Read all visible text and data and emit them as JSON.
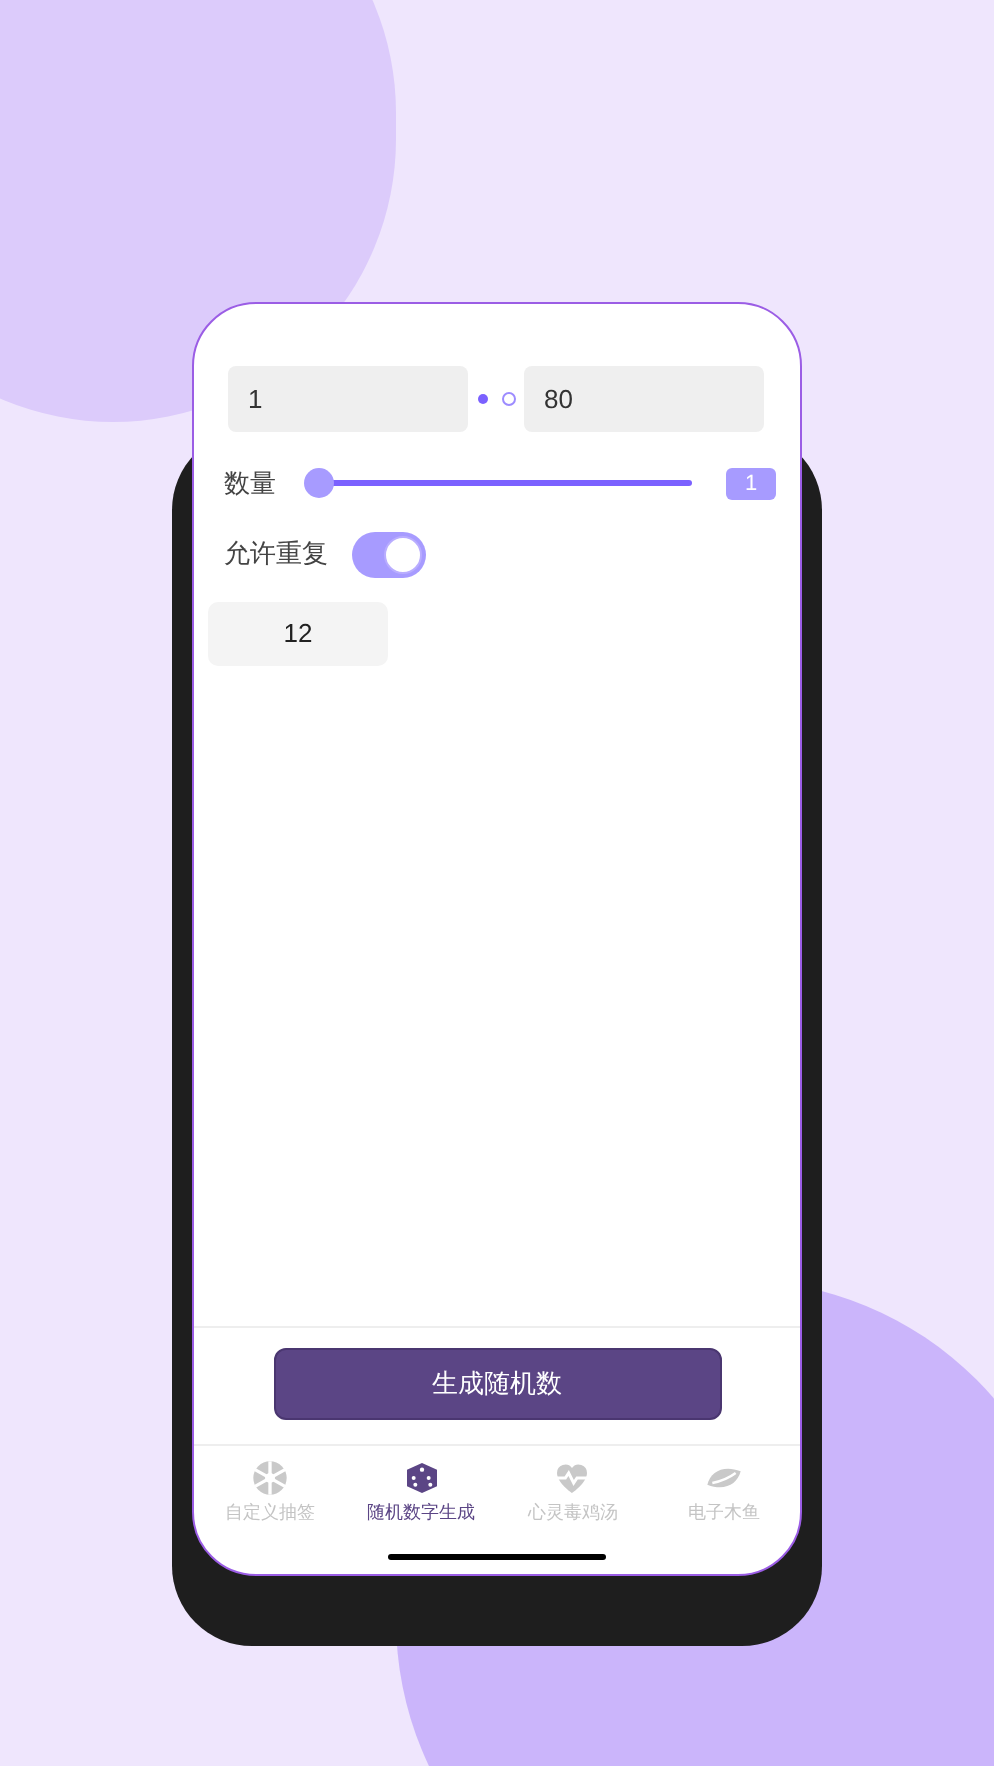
{
  "range": {
    "min_value": "1",
    "max_value": "80",
    "dots": [
      {
        "selected": true
      },
      {
        "selected": false
      }
    ]
  },
  "count": {
    "label": "数量",
    "level": 0,
    "value": "1"
  },
  "allow_repeat": {
    "label": "允许重复",
    "on": true
  },
  "results": [
    "12"
  ],
  "generate_button": "生成随机数",
  "tabs": [
    {
      "label": "自定义抽签",
      "kind": "wheel",
      "selected": false
    },
    {
      "label": "随机数字生成",
      "kind": "dice",
      "selected": true
    },
    {
      "label": "心灵毒鸡汤",
      "kind": "heart",
      "selected": false
    },
    {
      "label": "电子木鱼",
      "kind": "fish",
      "selected": false
    }
  ]
}
